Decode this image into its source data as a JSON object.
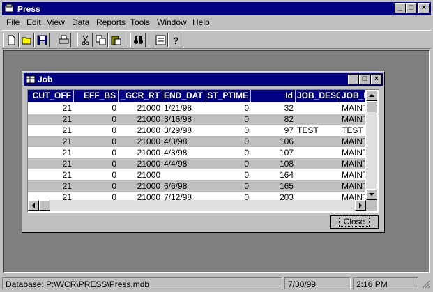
{
  "app": {
    "title": "Press"
  },
  "menu": [
    {
      "label": "File"
    },
    {
      "label": "Edit"
    },
    {
      "label": "View"
    },
    {
      "label": "Data"
    },
    {
      "label": "Reports"
    },
    {
      "label": "Tools"
    },
    {
      "label": "Window"
    },
    {
      "label": "Help"
    }
  ],
  "toolbar": {
    "icons": [
      "new-file-icon",
      "open-folder-icon",
      "save-icon",
      "print-icon",
      "cut-icon",
      "copy-icon",
      "paste-icon",
      "find-binoculars-icon",
      "properties-icon",
      "help-icon"
    ]
  },
  "child": {
    "title": "Job",
    "columns": [
      "CUT_OFF",
      "EFF_BS",
      "_GCR_RT",
      "END_DAT",
      "ST_PTIME",
      "Id",
      "JOB_DESC",
      "JOB_N"
    ],
    "rows": [
      [
        "21",
        "0",
        "21000",
        "1/21/98",
        "0",
        "32",
        "",
        "MAINT"
      ],
      [
        "21",
        "0",
        "21000",
        "3/16/98",
        "0",
        "82",
        "",
        "MAINT"
      ],
      [
        "21",
        "0",
        "21000",
        "3/29/98",
        "0",
        "97",
        "TEST",
        "TEST"
      ],
      [
        "21",
        "0",
        "21000",
        "4/3/98",
        "0",
        "106",
        "",
        "MAINT"
      ],
      [
        "21",
        "0",
        "21000",
        "4/3/98",
        "0",
        "107",
        "",
        "MAINT"
      ],
      [
        "21",
        "0",
        "21000",
        "4/4/98",
        "0",
        "108",
        "",
        "MAINT"
      ],
      [
        "21",
        "0",
        "21000",
        "",
        "0",
        "164",
        "",
        "MAINT"
      ],
      [
        "21",
        "0",
        "21000",
        "6/6/98",
        "0",
        "165",
        "",
        "MAINT"
      ],
      [
        "21",
        "0",
        "21000",
        "7/12/98",
        "0",
        "203",
        "",
        "MAINT"
      ]
    ],
    "close_label": "Close"
  },
  "status": {
    "database": "Database:  P:\\WCR\\PRESS\\Press.mdb",
    "date": "7/30/99",
    "time": "2:16 PM"
  }
}
